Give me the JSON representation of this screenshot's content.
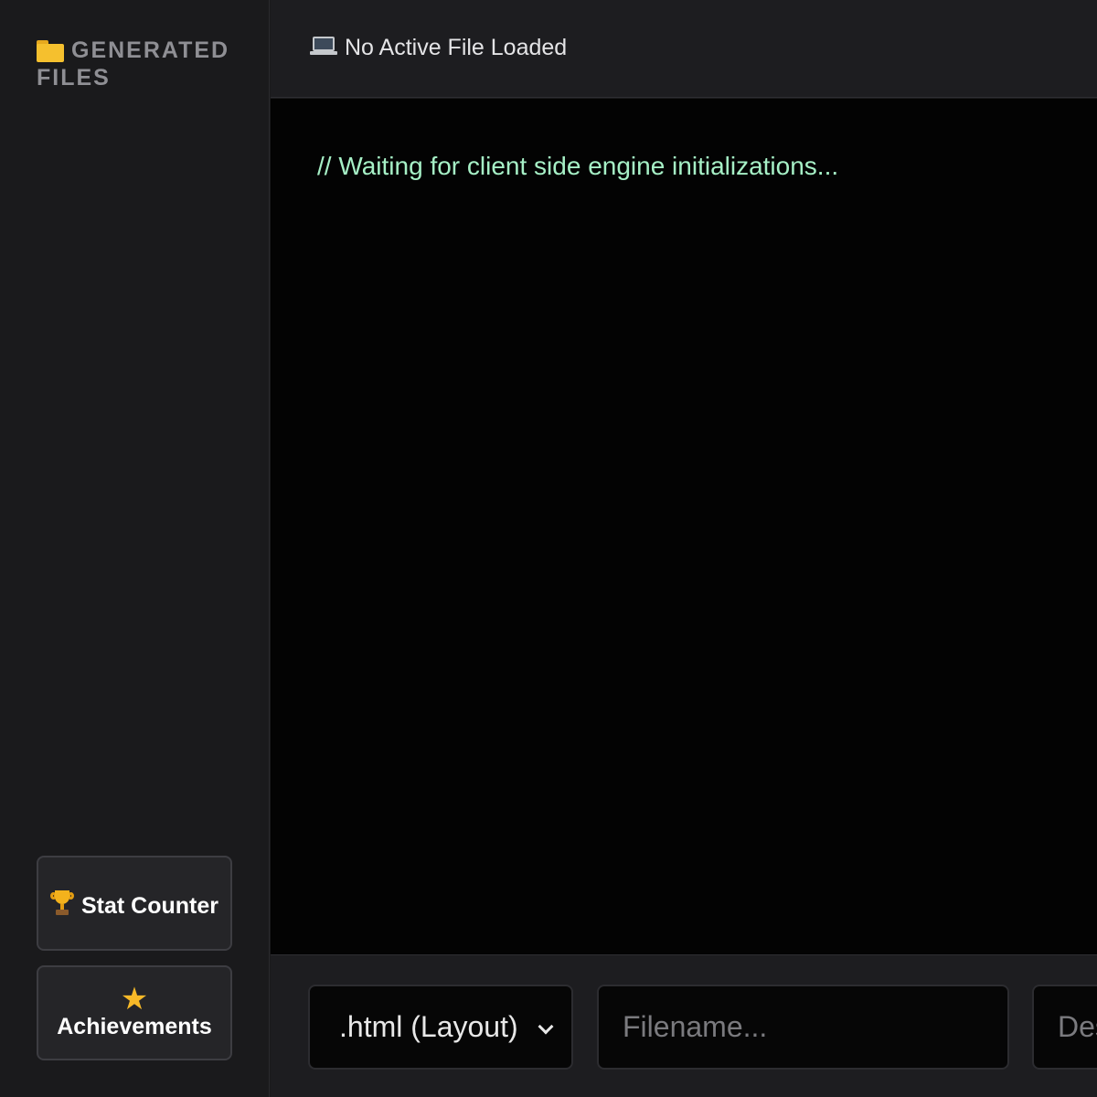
{
  "sidebar": {
    "title": "GENERATED FILES",
    "stat_button_label": "Stat Counter",
    "achievements_button_label": "Achievements"
  },
  "header": {
    "file_status": "No Active File Loaded"
  },
  "editor": {
    "content": "// Waiting for client side engine initializations..."
  },
  "footer": {
    "file_type_select": {
      "selected": ".html (Layout)"
    },
    "filename_input": {
      "value": "",
      "placeholder": "Filename..."
    },
    "description_input": {
      "value": "",
      "placeholder": "Description..."
    }
  },
  "icons": {
    "sidebar_title": "folder-icon",
    "header_status": "laptop-icon",
    "stat_button": "trophy-icon",
    "achievements_button": "star-icon",
    "select_arrow": "chevron-down-icon"
  },
  "colors": {
    "sidebar_bg": "#1a1a1c",
    "editor_bg": "#030303",
    "comment_text": "#a6f0c6",
    "sidebar_title_text": "#8f8f94"
  }
}
